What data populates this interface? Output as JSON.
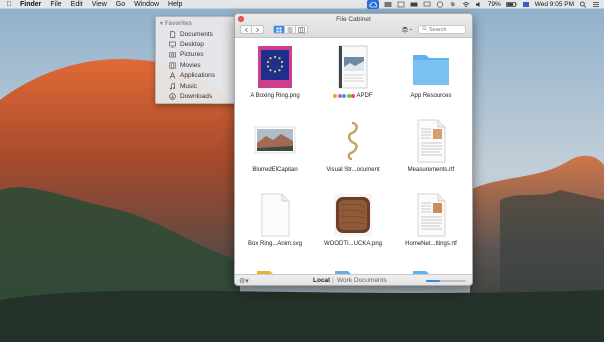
{
  "menubar": {
    "apple": "",
    "app_name": "Finder",
    "menus": [
      "File",
      "Edit",
      "View",
      "Go",
      "Window",
      "Help"
    ],
    "battery": "79%",
    "clock": "Wed 9:05 PM"
  },
  "sidebar": {
    "header": "Favorites",
    "items": [
      {
        "label": "Documents",
        "icon": "document-icon"
      },
      {
        "label": "Desktop",
        "icon": "desktop-icon"
      },
      {
        "label": "Pictures",
        "icon": "camera-icon"
      },
      {
        "label": "Movies",
        "icon": "film-icon"
      },
      {
        "label": "Applications",
        "icon": "applications-icon"
      },
      {
        "label": "Music",
        "icon": "music-icon"
      },
      {
        "label": "Downloads",
        "icon": "download-icon"
      }
    ]
  },
  "window": {
    "title": "File Cabinet",
    "search_placeholder": "Search",
    "view_mode": "icon",
    "files": [
      {
        "name": "A Boxing Ring.png",
        "kind": "image-eu"
      },
      {
        "name": "APDF",
        "kind": "pdf",
        "tags": [
          "#e8a03a",
          "#c45bd6",
          "#3aa0e8",
          "#7ac142",
          "#e85050"
        ]
      },
      {
        "name": "App Resources",
        "kind": "folder"
      },
      {
        "name": "BlurredElCapitan",
        "kind": "photo"
      },
      {
        "name": "Visual Str...ocument",
        "kind": "script"
      },
      {
        "name": "Measurements.rtf",
        "kind": "rtf"
      },
      {
        "name": "Box Ring...Anim.svg",
        "kind": "blank"
      },
      {
        "name": "WOODTI...UCKA.png",
        "kind": "wood"
      },
      {
        "name": "HomeNet...ttings.rtf",
        "kind": "rtf"
      },
      {
        "name": "",
        "kind": "folder-yellow"
      },
      {
        "name": "",
        "kind": "folder"
      },
      {
        "name": "",
        "kind": "folder"
      }
    ]
  },
  "bottombar": {
    "local": "Local",
    "separator": "|",
    "work_docs": "Work Documents",
    "zoom_level": 0.35
  },
  "colors": {
    "accent": "#3b87f0",
    "folder_blue": "#5fb3ec",
    "folder_yellow": "#f3c34a",
    "close": "#ee5a52"
  }
}
